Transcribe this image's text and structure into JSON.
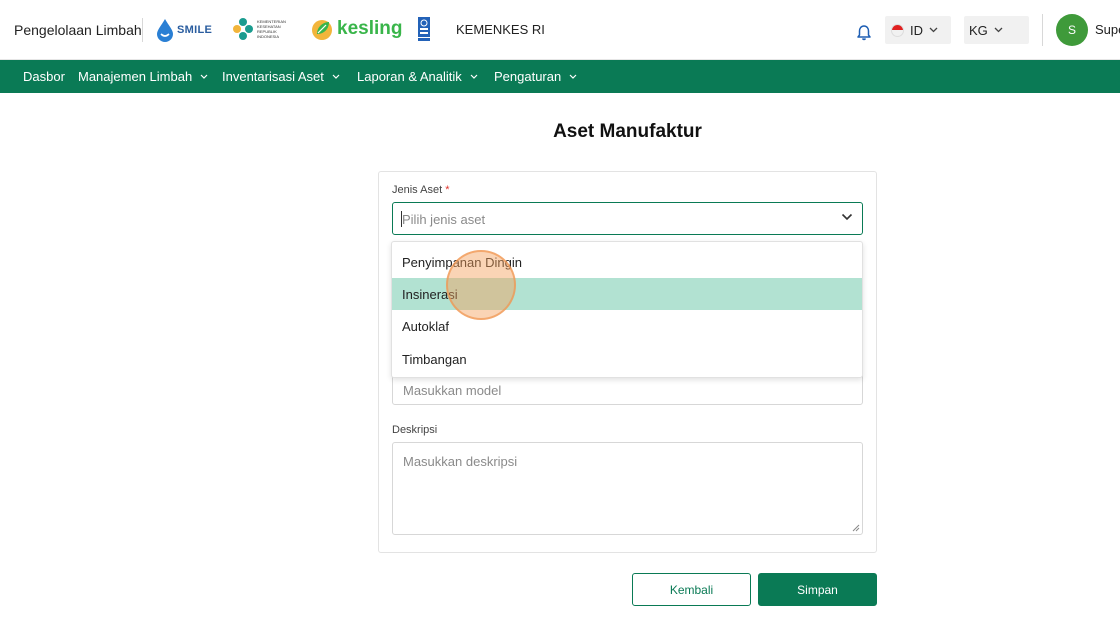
{
  "header": {
    "app_title": "Pengelolaan Limbah",
    "logos": {
      "smile": "SMILE",
      "kemenkes": "KEMENTERIAN KESEHATAN REPUBLIK INDONESIA",
      "kesling": "kesling"
    },
    "org_label": "KEMENKES RI",
    "language": "ID",
    "unit": "KG",
    "avatar_initial": "S",
    "user_name": "Super"
  },
  "nav": {
    "items": [
      {
        "label": "Dasbor",
        "has_dropdown": false
      },
      {
        "label": "Manajemen Limbah",
        "has_dropdown": true
      },
      {
        "label": "Inventarisasi Aset",
        "has_dropdown": true
      },
      {
        "label": "Laporan & Analitik",
        "has_dropdown": true
      },
      {
        "label": "Pengaturan",
        "has_dropdown": true
      }
    ]
  },
  "page": {
    "title": "Aset Manufaktur"
  },
  "form": {
    "asset_type": {
      "label": "Jenis Aset",
      "required_mark": "*",
      "placeholder": "Pilih jenis aset",
      "options": [
        "Penyimpanan Dingin",
        "Insinerasi",
        "Autoklaf",
        "Timbangan"
      ],
      "highlighted_option": "Insinerasi"
    },
    "model": {
      "placeholder": "Masukkan model"
    },
    "description": {
      "label": "Deskripsi",
      "placeholder": "Masukkan deskripsi"
    }
  },
  "actions": {
    "back_label": "Kembali",
    "save_label": "Simpan"
  },
  "colors": {
    "primary": "#0a7a55",
    "highlight": "#b2e2d2",
    "avatar": "#3f9a3a",
    "required": "#e0342c"
  }
}
